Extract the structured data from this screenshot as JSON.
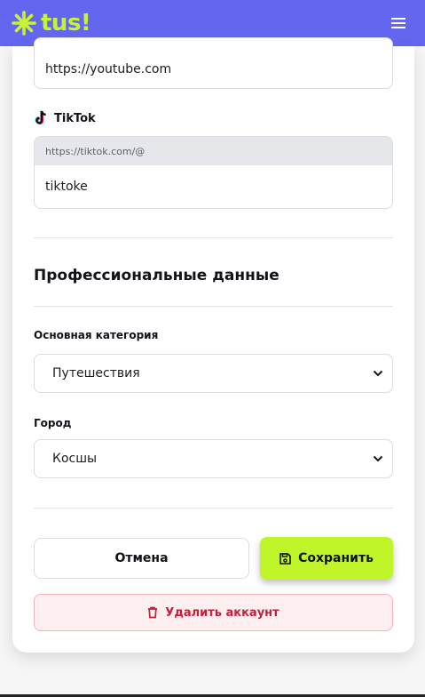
{
  "header": {
    "logo_text": "tus!",
    "logo_icon": "sparkle-icon",
    "menu_icon": "hamburger-menu-icon",
    "brand_color": "#6466f0",
    "accent_color": "#c0f52a"
  },
  "socials": {
    "youtube": {
      "value": "https://youtube.com"
    },
    "tiktok": {
      "label": "TikTok",
      "icon": "tiktok-icon",
      "prefix": "https://tiktok.com/@",
      "value": "tiktoke"
    }
  },
  "professional": {
    "title": "Профессиональные данные",
    "category": {
      "label": "Основная категория",
      "selected": "Путешествия"
    },
    "city": {
      "label": "Город",
      "selected": "Косшы"
    }
  },
  "actions": {
    "cancel_label": "Отмена",
    "save_label": "Сохранить",
    "save_icon": "save-icon",
    "delete_label": "Удалить аккаунт",
    "delete_icon": "trash-icon",
    "danger_color": "#c3203b"
  }
}
